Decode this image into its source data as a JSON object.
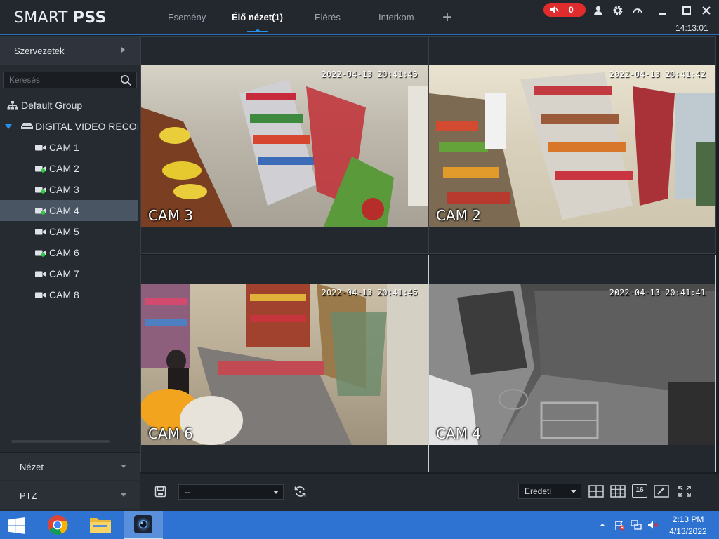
{
  "app": {
    "logo_light": "SMART ",
    "logo_bold": "PSS",
    "tabs": [
      "Esemény",
      "Élő nézet(1)",
      "Elérés",
      "Interkom"
    ],
    "add_tab": "+",
    "alarm_count": "0",
    "clock": "14:13:01"
  },
  "sidebar": {
    "org_title": "Szervezetek",
    "search_placeholder": "Keresés",
    "group": "Default Group",
    "device": "DIGITAL VIDEO RECORDER",
    "cameras": [
      "CAM 1",
      "CAM 2",
      "CAM 3",
      "CAM 4",
      "CAM 5",
      "CAM 6",
      "CAM 7",
      "CAM 8"
    ],
    "view_panel": "Nézet",
    "ptz_panel": "PTZ"
  },
  "grid": {
    "cells": [
      {
        "label": "CAM 3",
        "timestamp": "2022-04-13 20:41:45"
      },
      {
        "label": "CAM 2",
        "timestamp": "2022-04-13 20:41:42"
      },
      {
        "label": "CAM 6",
        "timestamp": "2022-04-13 20:41:45"
      },
      {
        "label": "CAM 4",
        "timestamp": "2022-04-13 20:41:41"
      }
    ]
  },
  "toolbar": {
    "view_select": "--",
    "ratio_select": "Eredeti",
    "split_16": "16"
  },
  "taskbar": {
    "time": "2:13 PM",
    "date": "4/13/2022"
  },
  "colors": {
    "accent": "#2a8fe8",
    "alarm": "#e02c2c",
    "online": "#2ecc40",
    "taskbar": "#2e73d1"
  }
}
